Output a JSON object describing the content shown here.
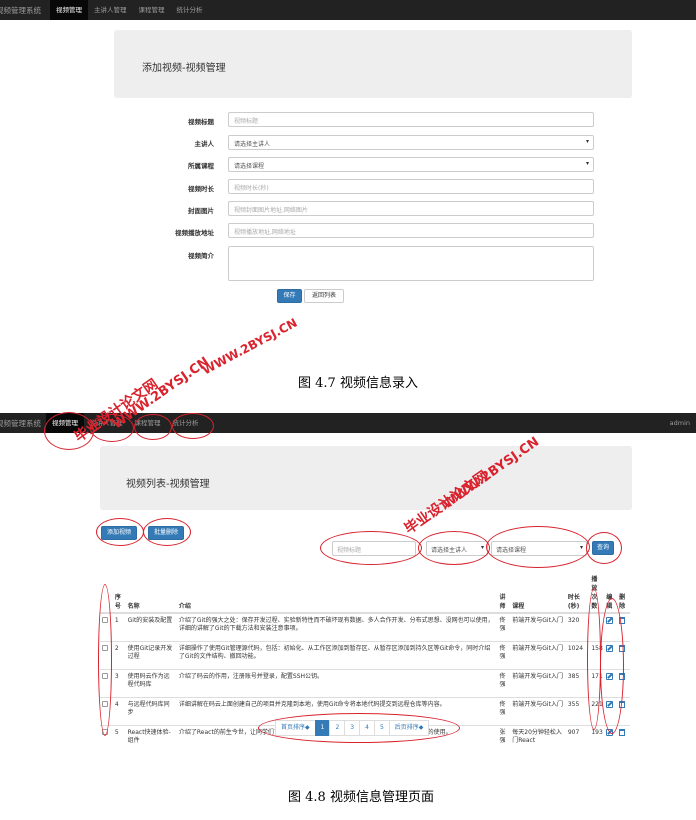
{
  "nav1": {
    "brand": "视频管理系统",
    "items": [
      "视频管理",
      "主讲人管理",
      "课程管理",
      "统计分析"
    ]
  },
  "form": {
    "title": "添加视频-视频管理",
    "fields": [
      {
        "label": "视频标题",
        "placeholder": "视频标题"
      },
      {
        "label": "主讲人",
        "value": "请选择主讲人"
      },
      {
        "label": "所属课程",
        "value": "请选择课程"
      },
      {
        "label": "视频时长",
        "placeholder": "视频时长(秒)"
      },
      {
        "label": "封面图片",
        "placeholder": "视频封面图片地址,网络图片"
      },
      {
        "label": "视频播放地址",
        "placeholder": "视频播放地址,网络地址"
      },
      {
        "label": "视频简介",
        "placeholder": ""
      }
    ],
    "save_label": "保存",
    "back_label": "返回列表"
  },
  "caption1": "图 4.7 视频信息录入",
  "nav2": {
    "brand": "视频管理系统",
    "items": [
      "视频管理",
      "主讲人管理",
      "课程管理",
      "统计分析"
    ],
    "user": "admin"
  },
  "list": {
    "title": "视频列表-视频管理",
    "add_label": "添加视频",
    "batch_delete_label": "批量删除",
    "search_placeholder": "视频标题",
    "speaker_select": "请选择主讲人",
    "course_select": "请选择课程",
    "query_label": "查询",
    "headers": {
      "index": "序号",
      "name": "名称",
      "intro": "介绍",
      "speaker": "讲师",
      "course": "课程",
      "duration": "时长(秒)",
      "plays": "播放次数",
      "edit": "编辑",
      "delete": "删除"
    },
    "rows": [
      {
        "index": "1",
        "name": "Git的安装及配置",
        "intro": "介绍了Git的强大之处：保存开发过程、实验新特性而不破坏现有数据、多人合作开发、分布式思想、没网也可以使用，详细的讲解了Git的下载方法和安装注意事项。",
        "speaker": "佟强",
        "course": "前端开发与Git入门",
        "duration": "320",
        "plays": ""
      },
      {
        "index": "2",
        "name": "使用Git记录开发过程",
        "intro": "详细操作了使用Git管理源代码，包括：初始化、从工作区添加到暂存区、从暂存区添加到持久区等Git命令，同时介绍了Git的文件结构、撤回功能。",
        "speaker": "佟强",
        "course": "前端开发与Git入门",
        "duration": "1024",
        "plays": "158"
      },
      {
        "index": "3",
        "name": "使用码云作为远程代码库",
        "intro": "介绍了码云的作用，注册账号并登录，配置SSH公钥。",
        "speaker": "佟强",
        "course": "前端开发与Git入门",
        "duration": "385",
        "plays": "171"
      },
      {
        "index": "4",
        "name": "与远程代码库同步",
        "intro": "详细讲解在码云上面创建自己的项目并克隆到本地，使用Git命令将本地代码提交到远程仓库等内容。",
        "speaker": "佟强",
        "course": "前端开发与Git入门",
        "duration": "355",
        "plays": "221"
      },
      {
        "index": "5",
        "name": "React快速体验-组件",
        "intro": "介绍了React的前生今世，让同学们了解库文件下载和整体的React项目结构及React库最简单的使用。",
        "speaker": "张强",
        "course": "每天20分钟轻松入门React",
        "duration": "907",
        "plays": "193"
      }
    ]
  },
  "pagination": {
    "prev": "首页排序◆",
    "pages": [
      "1",
      "2",
      "3",
      "4",
      "5"
    ],
    "next": "后页排序◆"
  },
  "caption2": "图 4.8 视频信息管理页面",
  "watermarks": {
    "text_cn": "毕业设计论文网",
    "text_url": "WWW.2BYSJ.CN"
  },
  "colors": {
    "primary": "#337ab7",
    "navbar": "#222222",
    "annotation_red": "#d9232e"
  }
}
